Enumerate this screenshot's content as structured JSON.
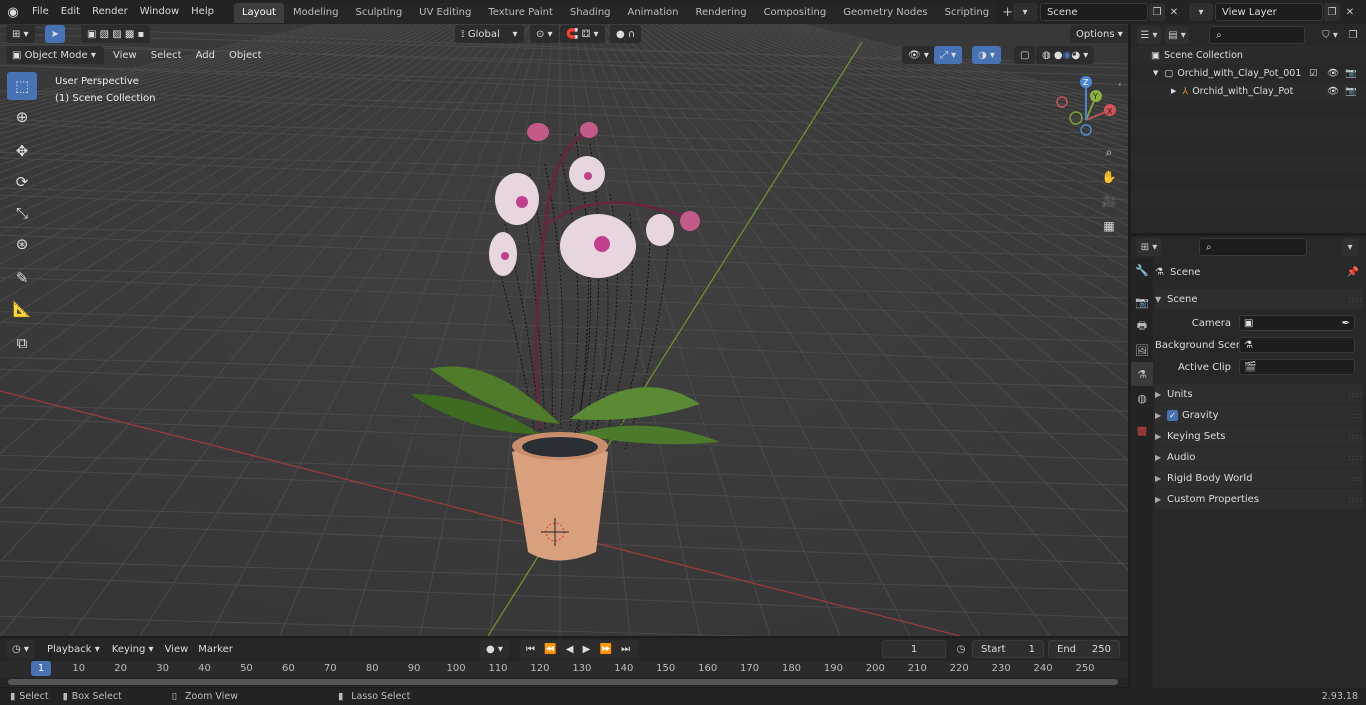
{
  "topbar": {
    "menus": [
      "File",
      "Edit",
      "Render",
      "Window",
      "Help"
    ],
    "tabs": [
      "Layout",
      "Modeling",
      "Sculpting",
      "UV Editing",
      "Texture Paint",
      "Shading",
      "Animation",
      "Rendering",
      "Compositing",
      "Geometry Nodes",
      "Scripting"
    ],
    "active_tab": "Layout",
    "scene_name": "Scene",
    "view_layer": "View Layer"
  },
  "viewport": {
    "mode": "Object Mode",
    "menus": [
      "View",
      "Select",
      "Add",
      "Object"
    ],
    "transform_orientation": "Global",
    "options_label": "Options",
    "perspective_label": "User Perspective",
    "collection_label": "(1) Scene Collection",
    "gizmo_axes": [
      "X",
      "Y",
      "Z"
    ]
  },
  "timeline": {
    "menus": [
      "Playback",
      "Keying",
      "View",
      "Marker"
    ],
    "current_frame": "1",
    "start_label": "Start",
    "start_value": "1",
    "end_label": "End",
    "end_value": "250",
    "ruler_ticks": [
      "1",
      "10",
      "20",
      "30",
      "40",
      "50",
      "60",
      "70",
      "80",
      "90",
      "100",
      "110",
      "120",
      "130",
      "140",
      "150",
      "160",
      "170",
      "180",
      "190",
      "200",
      "210",
      "220",
      "230",
      "240",
      "250"
    ]
  },
  "outliner": {
    "root": "Scene Collection",
    "items": [
      {
        "label": "Orchid_with_Clay_Pot_001"
      },
      {
        "label": "Orchid_with_Clay_Pot"
      }
    ]
  },
  "properties": {
    "header": "Scene",
    "section": "Scene",
    "fields": [
      {
        "label": "Camera"
      },
      {
        "label": "Background Scene"
      },
      {
        "label": "Active Clip"
      }
    ],
    "panels": [
      "Units",
      "Gravity",
      "Keying Sets",
      "Audio",
      "Rigid Body World",
      "Custom Properties"
    ]
  },
  "statusbar": {
    "select": "Select",
    "box_select": "Box Select",
    "zoom_view": "Zoom View",
    "lasso_select": "Lasso Select",
    "version": "2.93.18"
  }
}
